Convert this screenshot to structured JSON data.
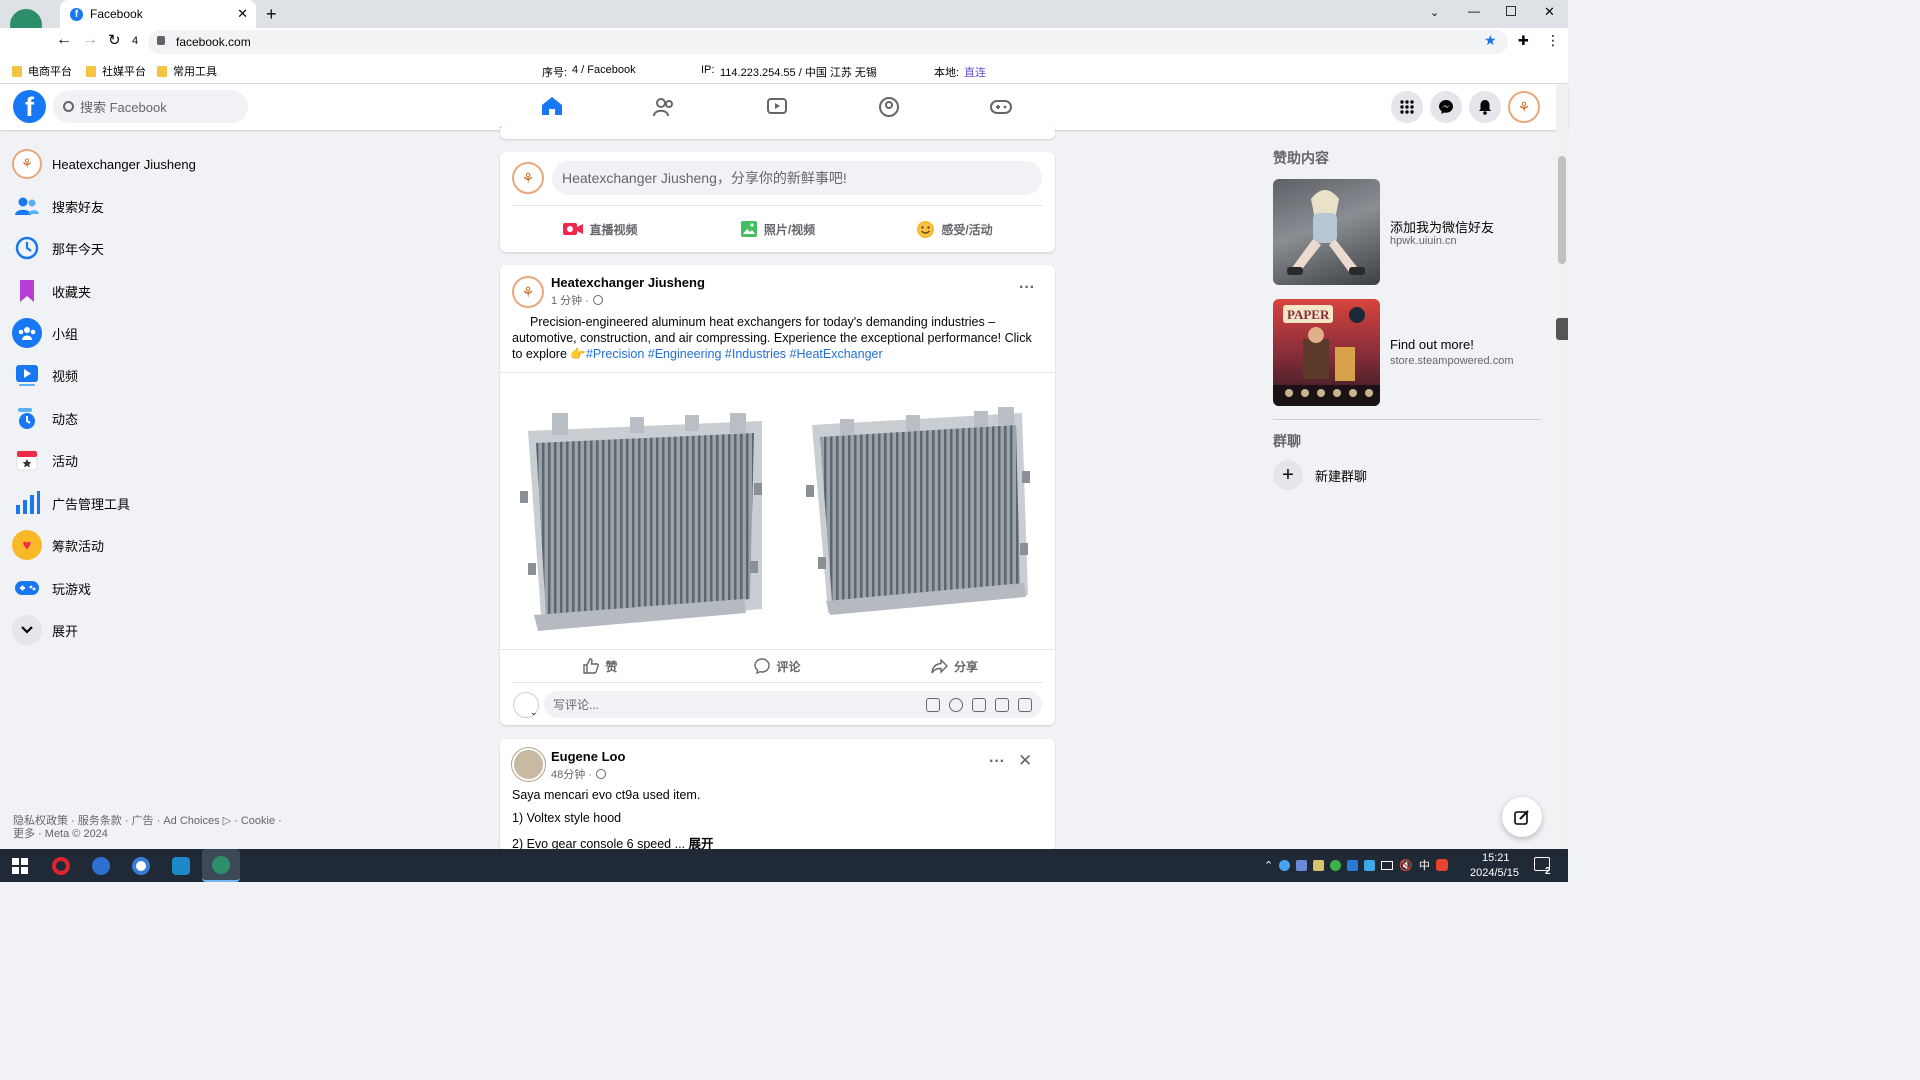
{
  "browser": {
    "tab_title": "Facebook",
    "tab_count": "4",
    "url": "facebook.com",
    "bookmarks": [
      "电商平台",
      "社媒平台",
      "常用工具"
    ],
    "info": {
      "seq_label": "序号:",
      "seq_value": "4 / Facebook",
      "ip_label": "IP:",
      "ip_value": "114.223.254.55 / 中国 江苏 无锡",
      "local_label": "本地:",
      "local_value": "直连"
    }
  },
  "header": {
    "search_placeholder": "搜索 Facebook",
    "brand_color": "#1877f2",
    "nav_icons": [
      "home-icon",
      "friends-icon",
      "watch-icon",
      "groups-icon",
      "gaming-icon"
    ],
    "right_icons": [
      "menu-grid-icon",
      "messenger-icon",
      "notifications-icon",
      "profile-avatar"
    ]
  },
  "sidebar": {
    "items": [
      {
        "label": "Heatexchanger Jiusheng",
        "icon": "profile-avatar"
      },
      {
        "label": "搜索好友",
        "icon": "friends-icon"
      },
      {
        "label": "那年今天",
        "icon": "memories-icon"
      },
      {
        "label": "收藏夹",
        "icon": "saved-icon"
      },
      {
        "label": "小组",
        "icon": "groups-icon"
      },
      {
        "label": "视频",
        "icon": "video-icon"
      },
      {
        "label": "动态",
        "icon": "feeds-icon"
      },
      {
        "label": "活动",
        "icon": "events-icon"
      },
      {
        "label": "广告管理工具",
        "icon": "ads-manager-icon"
      },
      {
        "label": "筹款活动",
        "icon": "fundraiser-icon"
      },
      {
        "label": "玩游戏",
        "icon": "gaming-icon"
      },
      {
        "label": "展开",
        "icon": "chevron-down-icon"
      }
    ],
    "footer_line1": "隐私权政策 · 服务条款 · 广告 · Ad Choices ▷ · Cookie ·",
    "footer_line2": "更多 · Meta © 2024"
  },
  "composer": {
    "placeholder": "Heatexchanger Jiusheng，分享你的新鲜事吧!",
    "live": "直播视频",
    "photo": "照片/视频",
    "feeling": "感受/活动"
  },
  "post1": {
    "author": "Heatexchanger Jiusheng",
    "time": "1 分钟 ·",
    "text": "Precision-engineered aluminum heat exchangers for today's demanding industries – automotive, construction, and air compressing. Experience the exceptional performance! Click to explore 👉",
    "hashtags": "#Precision #Engineering #Industries #HeatExchanger",
    "like": "赞",
    "comment": "评论",
    "share": "分享",
    "comment_placeholder": "写评论..."
  },
  "post2": {
    "author": "Eugene Loo",
    "time": "48分钟 ·",
    "line1": "Saya mencari evo ct9a used item.",
    "line2": "1) Voltex style hood",
    "line3": "2) Evo gear console 6 speed ...",
    "more": "展开"
  },
  "right": {
    "sponsored_title": "赞助内容",
    "ads": [
      {
        "title": "添加我为微信好友",
        "domain": "hpwk.uiuin.cn"
      },
      {
        "title": "Find out more!",
        "domain": "store.steampowered.com"
      }
    ],
    "group_chats_title": "群聊",
    "new_group": "新建群聊"
  },
  "taskbar": {
    "time": "15:21",
    "date": "2024/5/15",
    "ime": "中",
    "notif_count": "2"
  }
}
